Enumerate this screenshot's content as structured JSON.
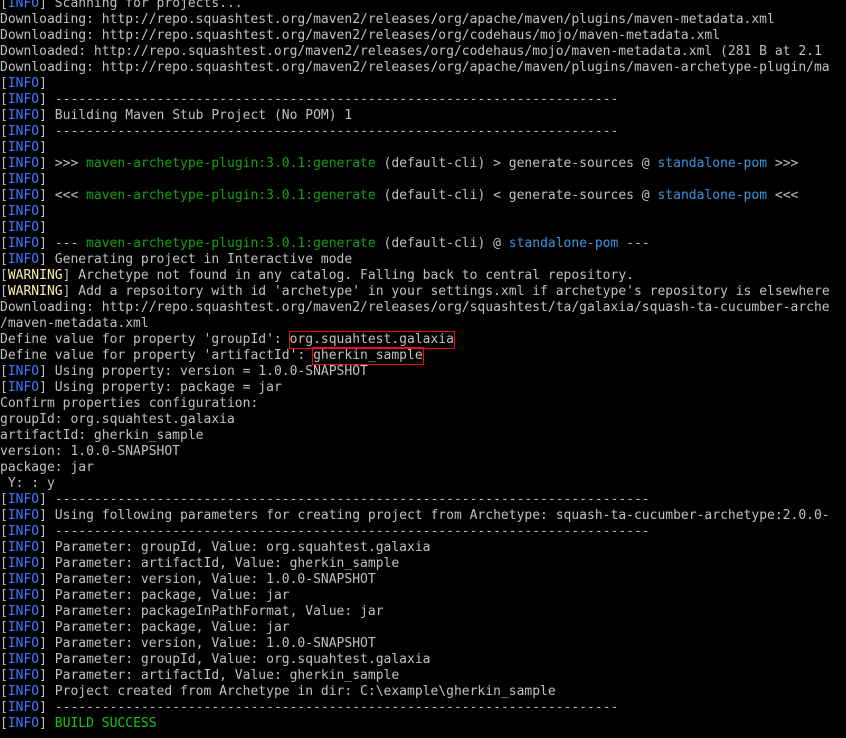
{
  "colors": {
    "background": "#000000",
    "text": "#c0c0c0",
    "info_tag": "#3b78ff",
    "warning_tag": "#f9f1a5",
    "plugin_green": "#13a10e",
    "pom_cyan": "#3a96dd",
    "success_green": "#16c60c",
    "highlight_box": "#e81123"
  },
  "lines": [
    {
      "segs": [
        {
          "t": "[",
          "c": "br"
        },
        {
          "t": "INFO",
          "c": "tag-info"
        },
        {
          "t": "] ",
          "c": "br"
        },
        {
          "t": "Scanning for projects..."
        }
      ]
    },
    {
      "segs": [
        {
          "t": "Downloading: http://repo.squashtest.org/maven2/releases/org/apache/maven/plugins/maven-metadata.xml"
        }
      ]
    },
    {
      "segs": [
        {
          "t": "Downloading: http://repo.squashtest.org/maven2/releases/org/codehaus/mojo/maven-metadata.xml"
        }
      ]
    },
    {
      "segs": [
        {
          "t": "Downloaded: http://repo.squashtest.org/maven2/releases/org/codehaus/mojo/maven-metadata.xml (281 B at 2.1"
        }
      ]
    },
    {
      "segs": [
        {
          "t": "Downloading: http://repo.squashtest.org/maven2/releases/org/apache/maven/plugins/maven-archetype-plugin/ma"
        }
      ]
    },
    {
      "segs": [
        {
          "t": "[",
          "c": "br"
        },
        {
          "t": "INFO",
          "c": "tag-info"
        },
        {
          "t": "]",
          "c": "br"
        }
      ]
    },
    {
      "segs": [
        {
          "t": "[",
          "c": "br"
        },
        {
          "t": "INFO",
          "c": "tag-info"
        },
        {
          "t": "] ",
          "c": "br"
        },
        {
          "t": "------------------------------------------------------------------------"
        }
      ]
    },
    {
      "segs": [
        {
          "t": "[",
          "c": "br"
        },
        {
          "t": "INFO",
          "c": "tag-info"
        },
        {
          "t": "] ",
          "c": "br"
        },
        {
          "t": "Building Maven Stub Project (No POM) 1"
        }
      ]
    },
    {
      "segs": [
        {
          "t": "[",
          "c": "br"
        },
        {
          "t": "INFO",
          "c": "tag-info"
        },
        {
          "t": "] ",
          "c": "br"
        },
        {
          "t": "------------------------------------------------------------------------"
        }
      ]
    },
    {
      "segs": [
        {
          "t": "[",
          "c": "br"
        },
        {
          "t": "INFO",
          "c": "tag-info"
        },
        {
          "t": "]",
          "c": "br"
        }
      ]
    },
    {
      "segs": [
        {
          "t": "[",
          "c": "br"
        },
        {
          "t": "INFO",
          "c": "tag-info"
        },
        {
          "t": "] ",
          "c": "br"
        },
        {
          "t": ">>> "
        },
        {
          "t": "maven-archetype-plugin:3.0.1:generate",
          "c": "grn"
        },
        {
          "t": " (default-cli) > generate-sources @ "
        },
        {
          "t": "standalone-pom",
          "c": "cyn"
        },
        {
          "t": " >>>"
        }
      ]
    },
    {
      "segs": [
        {
          "t": "[",
          "c": "br"
        },
        {
          "t": "INFO",
          "c": "tag-info"
        },
        {
          "t": "]",
          "c": "br"
        }
      ]
    },
    {
      "segs": [
        {
          "t": "[",
          "c": "br"
        },
        {
          "t": "INFO",
          "c": "tag-info"
        },
        {
          "t": "] ",
          "c": "br"
        },
        {
          "t": "<<< "
        },
        {
          "t": "maven-archetype-plugin:3.0.1:generate",
          "c": "grn"
        },
        {
          "t": " (default-cli) < generate-sources @ "
        },
        {
          "t": "standalone-pom",
          "c": "cyn"
        },
        {
          "t": " <<<"
        }
      ]
    },
    {
      "segs": [
        {
          "t": "[",
          "c": "br"
        },
        {
          "t": "INFO",
          "c": "tag-info"
        },
        {
          "t": "]",
          "c": "br"
        }
      ]
    },
    {
      "segs": [
        {
          "t": "[",
          "c": "br"
        },
        {
          "t": "INFO",
          "c": "tag-info"
        },
        {
          "t": "]",
          "c": "br"
        }
      ]
    },
    {
      "segs": [
        {
          "t": "[",
          "c": "br"
        },
        {
          "t": "INFO",
          "c": "tag-info"
        },
        {
          "t": "] ",
          "c": "br"
        },
        {
          "t": "--- "
        },
        {
          "t": "maven-archetype-plugin:3.0.1:generate",
          "c": "grn"
        },
        {
          "t": " (default-cli) @ "
        },
        {
          "t": "standalone-pom",
          "c": "cyn"
        },
        {
          "t": " ---"
        }
      ]
    },
    {
      "segs": [
        {
          "t": "[",
          "c": "br"
        },
        {
          "t": "INFO",
          "c": "tag-info"
        },
        {
          "t": "] ",
          "c": "br"
        },
        {
          "t": "Generating project in Interactive mode"
        }
      ]
    },
    {
      "segs": [
        {
          "t": "[",
          "c": "br"
        },
        {
          "t": "WARNING",
          "c": "tag-warn"
        },
        {
          "t": "] ",
          "c": "br"
        },
        {
          "t": "Archetype not found in any catalog. Falling back to central repository."
        }
      ]
    },
    {
      "segs": [
        {
          "t": "[",
          "c": "br"
        },
        {
          "t": "WARNING",
          "c": "tag-warn"
        },
        {
          "t": "] ",
          "c": "br"
        },
        {
          "t": "Add a repsoitory with id 'archetype' in your settings.xml if archetype's repository is elsewhere"
        }
      ]
    },
    {
      "segs": [
        {
          "t": "Downloading: http://repo.squashtest.org/maven2/releases/org/squashtest/ta/galaxia/squash-ta-cucumber-arche"
        }
      ]
    },
    {
      "segs": [
        {
          "t": "/maven-metadata.xml"
        }
      ]
    },
    {
      "segs": [
        {
          "t": "Define value for property 'groupId': "
        },
        {
          "t": "org.squahtest.galaxia",
          "c": "hl",
          "name": "groupid-input-value"
        }
      ]
    },
    {
      "segs": [
        {
          "t": "Define value for property 'artifactId': "
        },
        {
          "t": "gherkin_sample",
          "c": "hl",
          "name": "artifactid-input-value"
        }
      ]
    },
    {
      "segs": [
        {
          "t": "[",
          "c": "br"
        },
        {
          "t": "INFO",
          "c": "tag-info"
        },
        {
          "t": "] ",
          "c": "br"
        },
        {
          "t": "Using property: version = 1.0.0-SNAPSHOT"
        }
      ]
    },
    {
      "segs": [
        {
          "t": "[",
          "c": "br"
        },
        {
          "t": "INFO",
          "c": "tag-info"
        },
        {
          "t": "] ",
          "c": "br"
        },
        {
          "t": "Using property: package = jar"
        }
      ]
    },
    {
      "segs": [
        {
          "t": "Confirm properties configuration:"
        }
      ]
    },
    {
      "segs": [
        {
          "t": "groupId: org.squahtest.galaxia"
        }
      ]
    },
    {
      "segs": [
        {
          "t": "artifactId: gherkin_sample"
        }
      ]
    },
    {
      "segs": [
        {
          "t": "version: 1.0.0-SNAPSHOT"
        }
      ]
    },
    {
      "segs": [
        {
          "t": "package: jar"
        }
      ]
    },
    {
      "segs": [
        {
          "t": " Y: : y"
        }
      ]
    },
    {
      "segs": [
        {
          "t": "[",
          "c": "br"
        },
        {
          "t": "INFO",
          "c": "tag-info"
        },
        {
          "t": "] ",
          "c": "br"
        },
        {
          "t": "----------------------------------------------------------------------------"
        }
      ]
    },
    {
      "segs": [
        {
          "t": "[",
          "c": "br"
        },
        {
          "t": "INFO",
          "c": "tag-info"
        },
        {
          "t": "] ",
          "c": "br"
        },
        {
          "t": "Using following parameters for creating project from Archetype: squash-ta-cucumber-archetype:2.0.0-"
        }
      ]
    },
    {
      "segs": [
        {
          "t": "[",
          "c": "br"
        },
        {
          "t": "INFO",
          "c": "tag-info"
        },
        {
          "t": "] ",
          "c": "br"
        },
        {
          "t": "----------------------------------------------------------------------------"
        }
      ]
    },
    {
      "segs": [
        {
          "t": "[",
          "c": "br"
        },
        {
          "t": "INFO",
          "c": "tag-info"
        },
        {
          "t": "] ",
          "c": "br"
        },
        {
          "t": "Parameter: groupId, Value: org.squahtest.galaxia"
        }
      ]
    },
    {
      "segs": [
        {
          "t": "[",
          "c": "br"
        },
        {
          "t": "INFO",
          "c": "tag-info"
        },
        {
          "t": "] ",
          "c": "br"
        },
        {
          "t": "Parameter: artifactId, Value: gherkin_sample"
        }
      ]
    },
    {
      "segs": [
        {
          "t": "[",
          "c": "br"
        },
        {
          "t": "INFO",
          "c": "tag-info"
        },
        {
          "t": "] ",
          "c": "br"
        },
        {
          "t": "Parameter: version, Value: 1.0.0-SNAPSHOT"
        }
      ]
    },
    {
      "segs": [
        {
          "t": "[",
          "c": "br"
        },
        {
          "t": "INFO",
          "c": "tag-info"
        },
        {
          "t": "] ",
          "c": "br"
        },
        {
          "t": "Parameter: package, Value: jar"
        }
      ]
    },
    {
      "segs": [
        {
          "t": "[",
          "c": "br"
        },
        {
          "t": "INFO",
          "c": "tag-info"
        },
        {
          "t": "] ",
          "c": "br"
        },
        {
          "t": "Parameter: packageInPathFormat, Value: jar"
        }
      ]
    },
    {
      "segs": [
        {
          "t": "[",
          "c": "br"
        },
        {
          "t": "INFO",
          "c": "tag-info"
        },
        {
          "t": "] ",
          "c": "br"
        },
        {
          "t": "Parameter: package, Value: jar"
        }
      ]
    },
    {
      "segs": [
        {
          "t": "[",
          "c": "br"
        },
        {
          "t": "INFO",
          "c": "tag-info"
        },
        {
          "t": "] ",
          "c": "br"
        },
        {
          "t": "Parameter: version, Value: 1.0.0-SNAPSHOT"
        }
      ]
    },
    {
      "segs": [
        {
          "t": "[",
          "c": "br"
        },
        {
          "t": "INFO",
          "c": "tag-info"
        },
        {
          "t": "] ",
          "c": "br"
        },
        {
          "t": "Parameter: groupId, Value: org.squahtest.galaxia"
        }
      ]
    },
    {
      "segs": [
        {
          "t": "[",
          "c": "br"
        },
        {
          "t": "INFO",
          "c": "tag-info"
        },
        {
          "t": "] ",
          "c": "br"
        },
        {
          "t": "Parameter: artifactId, Value: gherkin_sample"
        }
      ]
    },
    {
      "segs": [
        {
          "t": "[",
          "c": "br"
        },
        {
          "t": "INFO",
          "c": "tag-info"
        },
        {
          "t": "] ",
          "c": "br"
        },
        {
          "t": "Project created from Archetype in dir: C:\\example\\gherkin_sample"
        }
      ]
    },
    {
      "segs": [
        {
          "t": "[",
          "c": "br"
        },
        {
          "t": "INFO",
          "c": "tag-info"
        },
        {
          "t": "] ",
          "c": "br"
        },
        {
          "t": "------------------------------------------------------------------------"
        }
      ]
    },
    {
      "segs": [
        {
          "t": "[",
          "c": "br"
        },
        {
          "t": "INFO",
          "c": "tag-info"
        },
        {
          "t": "] ",
          "c": "br"
        },
        {
          "t": "BUILD SUCCESS",
          "c": "success"
        }
      ]
    }
  ]
}
